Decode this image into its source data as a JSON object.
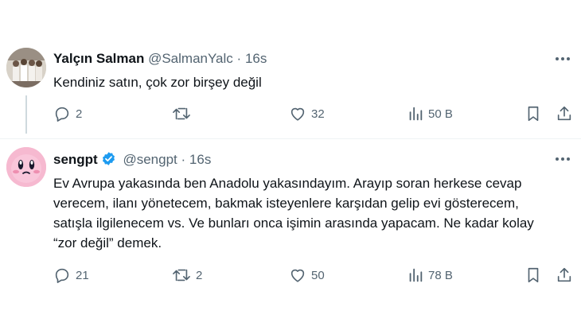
{
  "tweets": [
    {
      "name": "Yalçın Salman",
      "handle": "@SalmanYalc",
      "separator": "·",
      "time": "16s",
      "text": "Kendiniz satın, çok zor birşey değil",
      "replies": "2",
      "retweets": "",
      "likes": "32",
      "views": "50 B",
      "verified": false
    },
    {
      "name": "sengpt",
      "handle": "@sengpt",
      "separator": "·",
      "time": "16s",
      "text": "Ev Avrupa yakasında ben Anadolu yakasındayım. Arayıp soran herkese cevap verecem, ilanı yönetecem, bakmak isteyenlere karşıdan gelip evi gösterecem, satışla ilgilenecem vs. Ve bunları onca işimin arasında yapacam. Ne kadar kolay “zor değil” demek.",
      "replies": "21",
      "retweets": "2",
      "likes": "50",
      "views": "78 B",
      "verified": true
    }
  ],
  "colors": {
    "text": "#0f1419",
    "muted": "#536471",
    "verified_blue": "#1d9bf0",
    "avatar2_bg": "#f6b9d0"
  },
  "icons": [
    "more-icon",
    "reply-icon",
    "retweet-icon",
    "like-icon",
    "views-icon",
    "bookmark-icon",
    "share-icon",
    "verified-badge-icon"
  ]
}
